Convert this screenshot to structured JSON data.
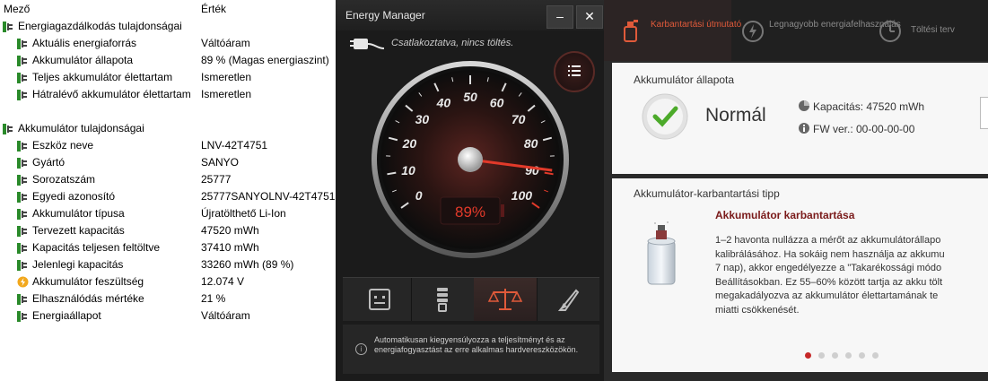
{
  "table": {
    "col_name": "Mező",
    "col_value": "Érték",
    "groups": [
      {
        "title": "Energiagazdálkodás tulajdonságai",
        "rows": [
          {
            "name": "Aktuális energiaforrás",
            "value": "Váltóáram"
          },
          {
            "name": "Akkumulátor állapota",
            "value": "89 % (Magas energiaszint)"
          },
          {
            "name": "Teljes akkumulátor élettartam",
            "value": "Ismeretlen"
          },
          {
            "name": "Hátralévő akkumulátor élettartam",
            "value": "Ismeretlen"
          }
        ]
      },
      {
        "title": "Akkumulátor tulajdonságai",
        "rows": [
          {
            "name": "Eszköz neve",
            "value": "LNV-42T4751"
          },
          {
            "name": "Gyártó",
            "value": "SANYO"
          },
          {
            "name": "Sorozatszám",
            "value": "25777"
          },
          {
            "name": "Egyedi azonosító",
            "value": "25777SANYOLNV-42T4751"
          },
          {
            "name": "Akkumulátor típusa",
            "value": "Újratölthető Li-Ion"
          },
          {
            "name": "Tervezett kapacitás",
            "value": "47520 mWh"
          },
          {
            "name": "Kapacitás teljesen feltöltve",
            "value": "37410 mWh"
          },
          {
            "name": "Jelenlegi kapacitás",
            "value": "33260 mWh  (89 %)"
          },
          {
            "name": "Akkumulátor feszültség",
            "value": "12.074 V",
            "icon": "lightning-icon"
          },
          {
            "name": "Elhasználódás mértéke",
            "value": "21 %"
          },
          {
            "name": "Energiaállapot",
            "value": "Váltóáram"
          }
        ]
      }
    ]
  },
  "energy_manager": {
    "title": "Energy Manager",
    "status": "Csatlakoztatva, nincs töltés.",
    "minimize": "–",
    "close": "✕",
    "gauge": {
      "ticks": [
        "0",
        "10",
        "20",
        "30",
        "40",
        "50",
        "60",
        "70",
        "80",
        "90",
        "100"
      ],
      "percent_label": "89%",
      "percent_value": 89
    },
    "modes": [
      "mode-battery-saver-icon",
      "mode-cooling-icon",
      "mode-balanced-icon",
      "mode-performance-icon"
    ],
    "info_text": "Automatikusan kiegyensúlyozza a teljesítményt és az energiafogyasztást az erre alkalmas hardvereszközökön."
  },
  "maintenance": {
    "tabs": [
      {
        "label": "Karbantartási\nútmutató",
        "active": true
      },
      {
        "label": "Legnagyobb\nenergiafelhasználás",
        "active": false
      },
      {
        "label": "Töltési terv",
        "active": false
      }
    ],
    "status_card": {
      "title": "Akkumulátor állapota",
      "status": "Normál",
      "capacity": "Kapacitás: 47520 mWh",
      "fw": "FW ver.: 00-00-00-00"
    },
    "tip_card": {
      "title": "Akkumulátor-karbantartási tipp",
      "tip_title": "Akkumulátor karbantartása",
      "tip_body": "1–2 havonta nullázza a mérőt az akkumulátorállapo\nkalibrálásához. Ha sokáig nem használja az akkumu\n7 nap), akkor engedélyezze a \"Takarékossági módo\nBeállításokban. Ez 55–60% között tartja az akku tölt\nmegakadályozva az akkumulátor élettartamának te\nmiatti csökkenését."
    },
    "pager_count": 6,
    "colors": {
      "accent": "#e05a3a",
      "dark_red": "#7a1a1a"
    }
  }
}
